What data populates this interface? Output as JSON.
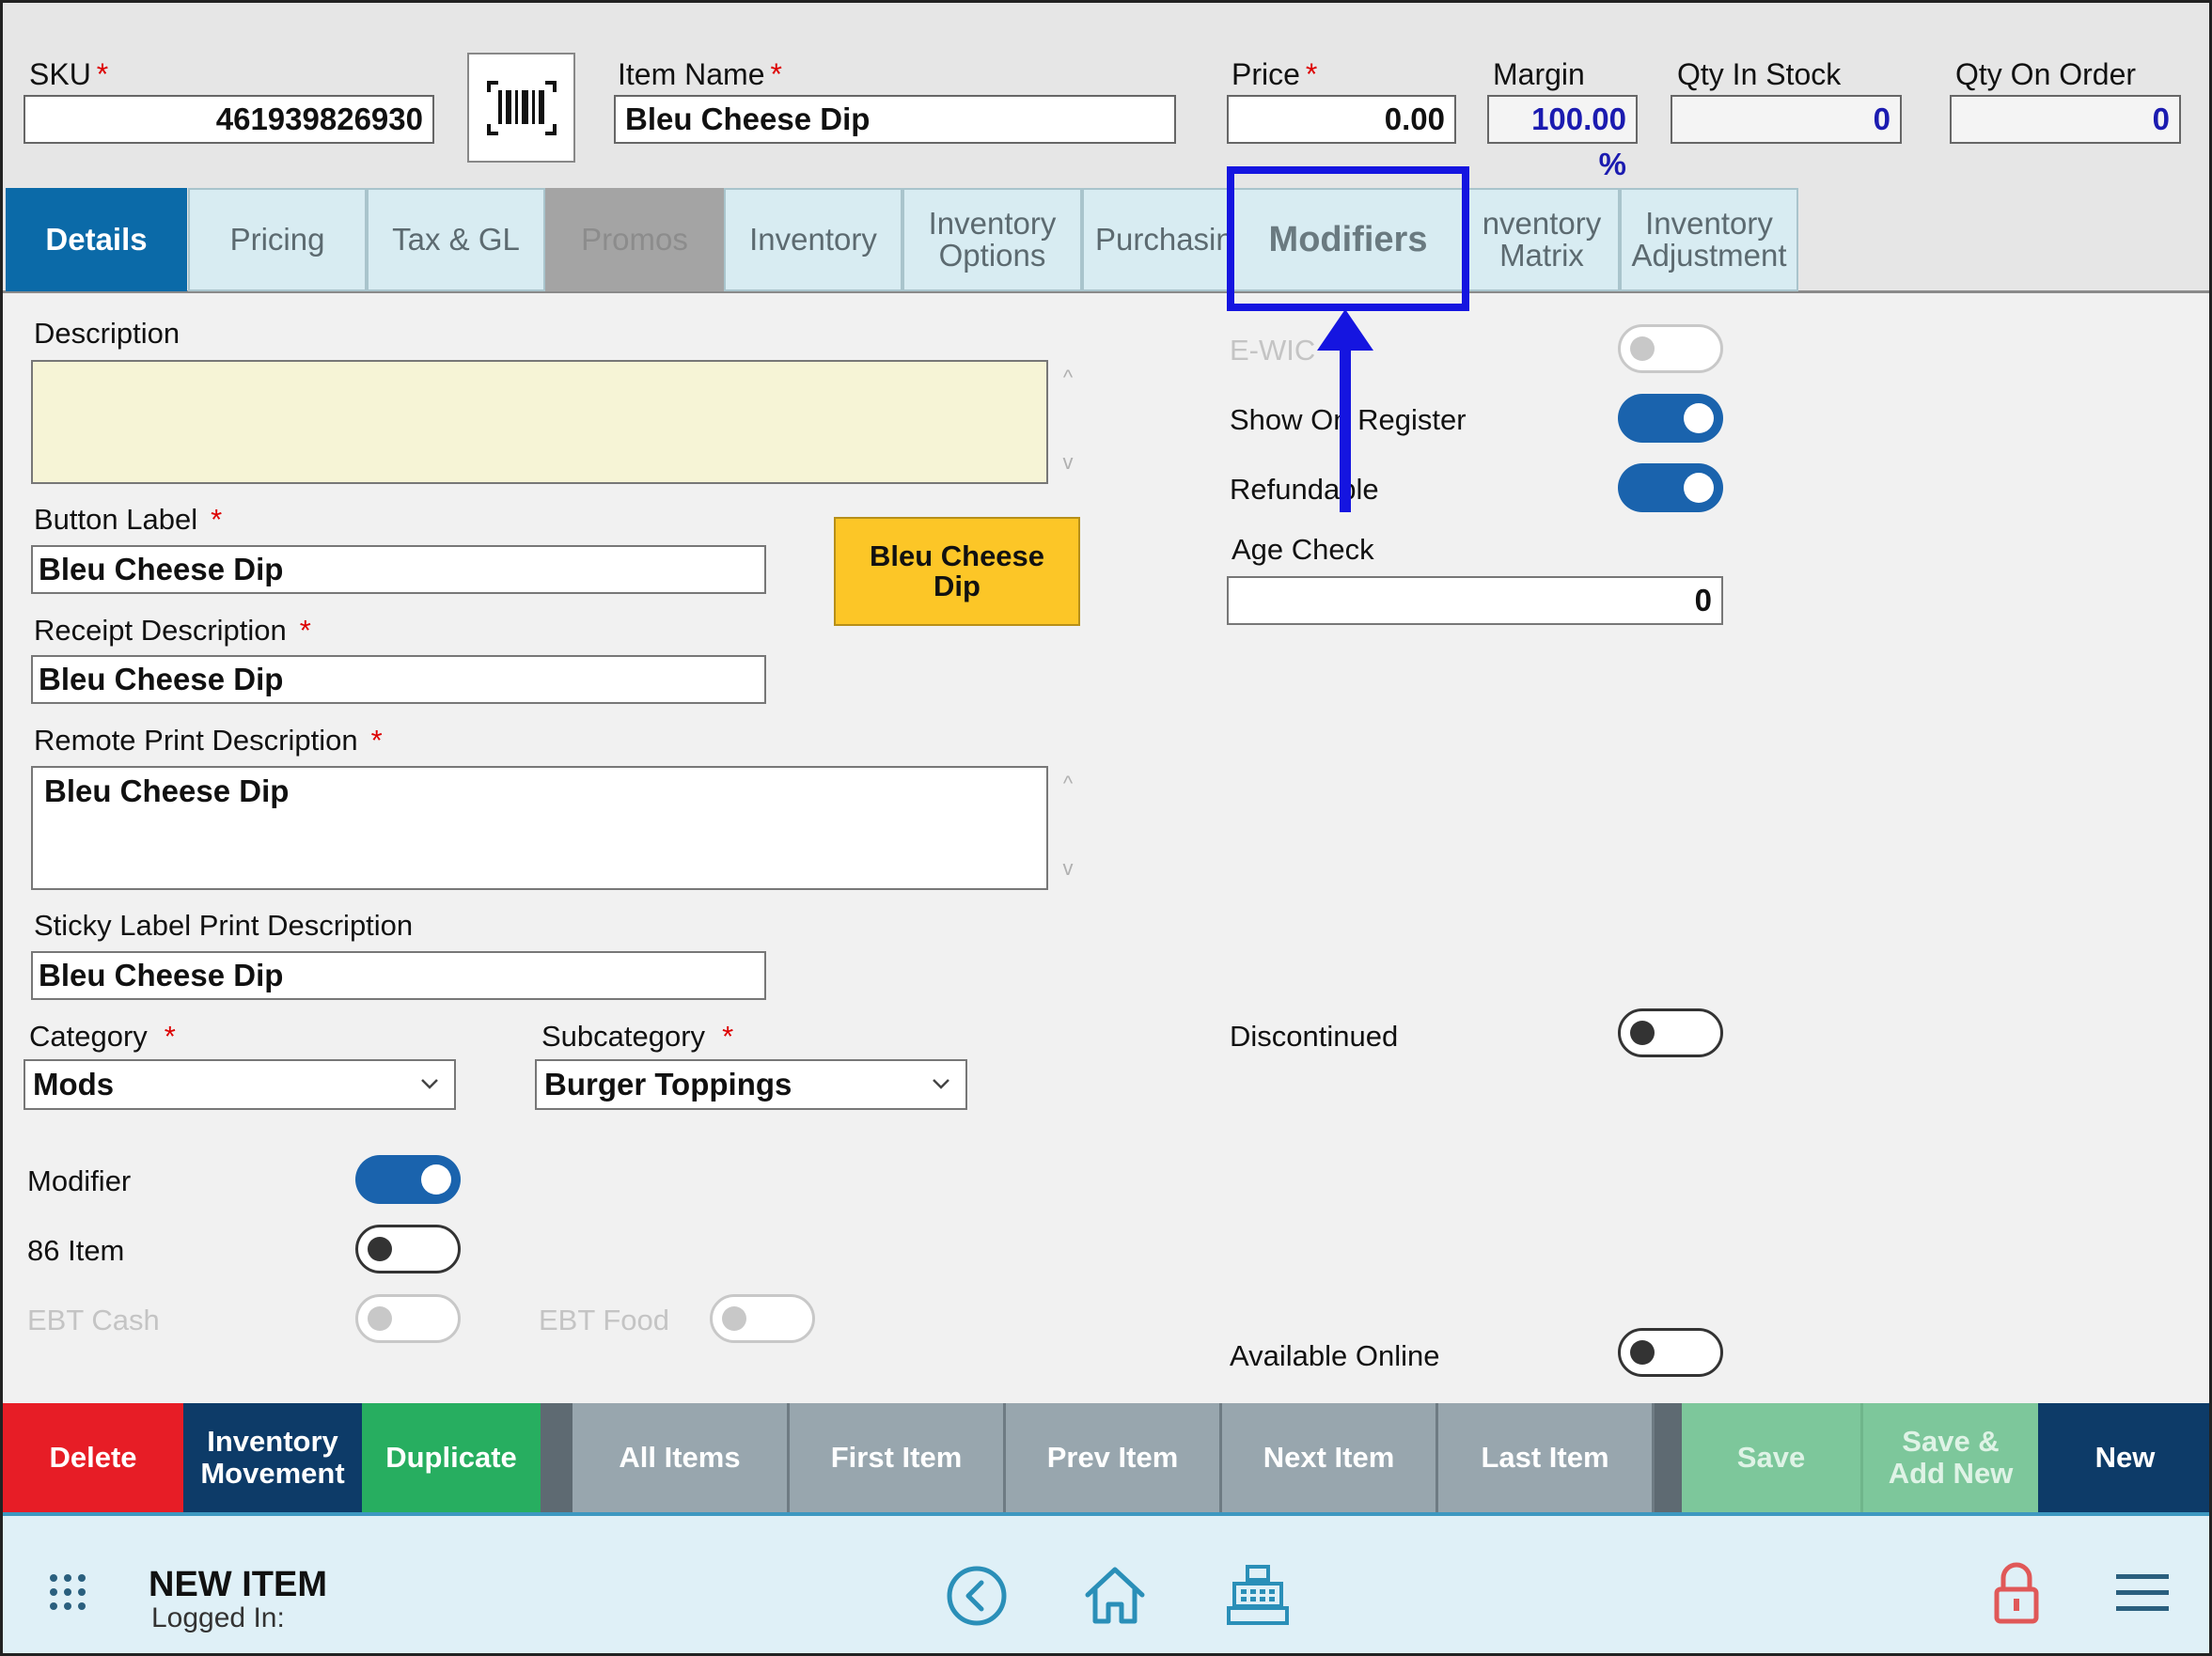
{
  "header": {
    "sku_label": "SKU",
    "sku_value": "461939826930",
    "item_name_label": "Item Name",
    "item_name_value": "Bleu Cheese Dip",
    "price_label": "Price",
    "price_value": "0.00",
    "margin_label": "Margin",
    "margin_value": "100.00 %",
    "qty_in_stock_label": "Qty In Stock",
    "qty_in_stock_value": "0",
    "qty_on_order_label": "Qty On Order",
    "qty_on_order_value": "0",
    "required_mark": "*"
  },
  "tabs": [
    {
      "label": "Details",
      "state": "active"
    },
    {
      "label": "Pricing",
      "state": "normal"
    },
    {
      "label": "Tax & GL",
      "state": "normal"
    },
    {
      "label": "Promos",
      "state": "disabled"
    },
    {
      "label": "Inventory",
      "state": "normal"
    },
    {
      "label": "Inventory\nOptions",
      "state": "normal"
    },
    {
      "label": "Purchasin",
      "state": "normal"
    },
    {
      "label": "Modifiers",
      "state": "highlighted"
    },
    {
      "label": "nventory\nMatrix",
      "state": "normal"
    },
    {
      "label": "Inventory\nAdjustment",
      "state": "normal"
    }
  ],
  "form": {
    "description_label": "Description",
    "description_value": "",
    "button_label_label": "Button Label",
    "button_label_value": "Bleu Cheese Dip",
    "button_preview_text": "Bleu Cheese Dip",
    "receipt_description_label": "Receipt Description",
    "receipt_description_value": "Bleu Cheese Dip",
    "remote_print_label": "Remote Print Description",
    "remote_print_value": "Bleu Cheese Dip",
    "sticky_label": "Sticky Label Print Description",
    "sticky_value": "Bleu Cheese Dip",
    "category_label": "Category",
    "category_value": "Mods",
    "subcategory_label": "Subcategory",
    "subcategory_value": "Burger Toppings",
    "scroll_up": "^",
    "scroll_down": "v"
  },
  "toggles": {
    "ewic": {
      "label": "E-WIC",
      "state": "disabled"
    },
    "show_on_register": {
      "label": "Show On Register",
      "state": "on"
    },
    "refundable": {
      "label": "Refundable",
      "state": "on"
    },
    "modifier": {
      "label": "Modifier",
      "state": "on"
    },
    "item86": {
      "label": "86 Item",
      "state": "off"
    },
    "ebt_cash": {
      "label": "EBT Cash",
      "state": "disabled"
    },
    "ebt_food": {
      "label": "EBT Food",
      "state": "disabled"
    },
    "discontinued": {
      "label": "Discontinued",
      "state": "off"
    },
    "available_online": {
      "label": "Available Online",
      "state": "off"
    }
  },
  "age_check": {
    "label": "Age Check",
    "value": "0"
  },
  "actions": {
    "delete": "Delete",
    "inventory_movement": "Inventory\nMovement",
    "duplicate": "Duplicate",
    "all_items": "All Items",
    "first_item": "First Item",
    "prev_item": "Prev Item",
    "next_item": "Next Item",
    "last_item": "Last Item",
    "save": "Save",
    "save_add_new": "Save &\nAdd New",
    "new": "New"
  },
  "bottom_bar": {
    "title": "NEW ITEM",
    "logged_in_label": "Logged In:",
    "icons": [
      "apps-grid-icon",
      "back-circle-icon",
      "home-icon",
      "register-icon",
      "lock-icon",
      "hamburger-menu-icon"
    ]
  },
  "colors": {
    "active_tab": "#0b6aa8",
    "tab_bg": "#d8ecf2",
    "highlight": "#1515e0",
    "delete": "#e71d26",
    "navy": "#0d3b68",
    "green": "#27ae60",
    "nav_gray": "#98a6ae",
    "toggle_on": "#1a63ad",
    "button_preview": "#fcc627",
    "bottom_bar": "#dff0f7",
    "accent_icon": "#2a8fb8",
    "lock_icon": "#e05858"
  }
}
